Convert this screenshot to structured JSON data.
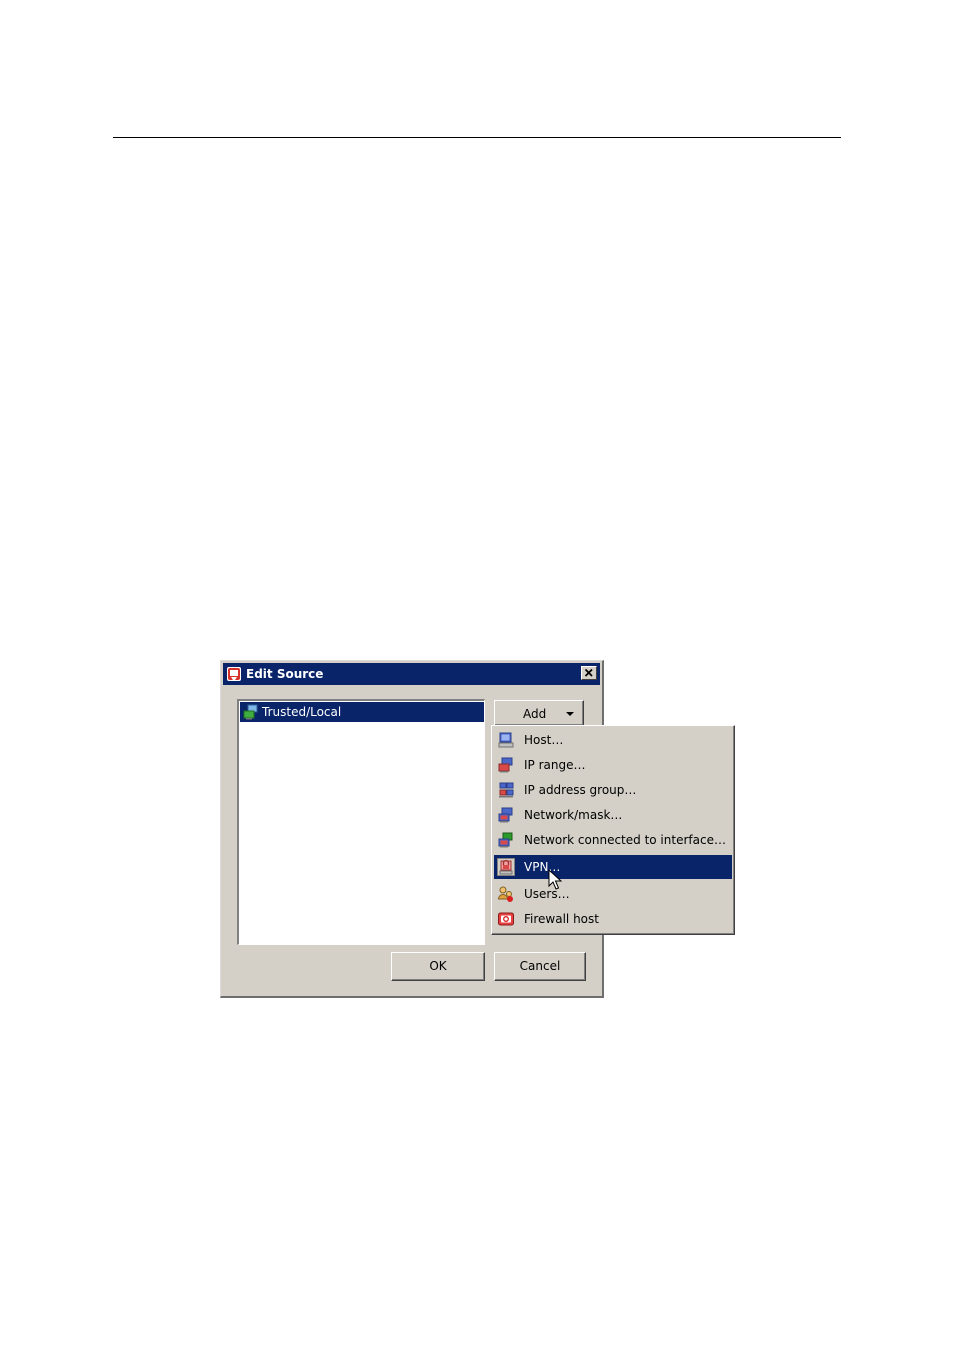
{
  "dialog": {
    "title": "Edit Source",
    "list_items": [
      {
        "label": "Trusted/Local",
        "icon": "network-icon"
      }
    ],
    "add_label": "Add",
    "ok_label": "OK",
    "cancel_label": "Cancel"
  },
  "menu": {
    "items": [
      {
        "label": "Host…",
        "icon": "host-icon"
      },
      {
        "label": "IP range…",
        "icon": "ip-range-icon"
      },
      {
        "label": "IP address group…",
        "icon": "ip-group-icon"
      },
      {
        "label": "Network/mask…",
        "icon": "network-mask-icon"
      },
      {
        "label": "Network connected to interface…",
        "icon": "network-interface-icon"
      },
      {
        "label": "VPN…",
        "icon": "vpn-icon"
      },
      {
        "label": "Users…",
        "icon": "users-icon"
      },
      {
        "label": "Firewall host",
        "icon": "firewall-host-icon"
      }
    ],
    "selected_index": 5
  },
  "colors": {
    "title_bar": "#0a246a",
    "selection": "#0a246a",
    "face": "#d4d0c8"
  }
}
